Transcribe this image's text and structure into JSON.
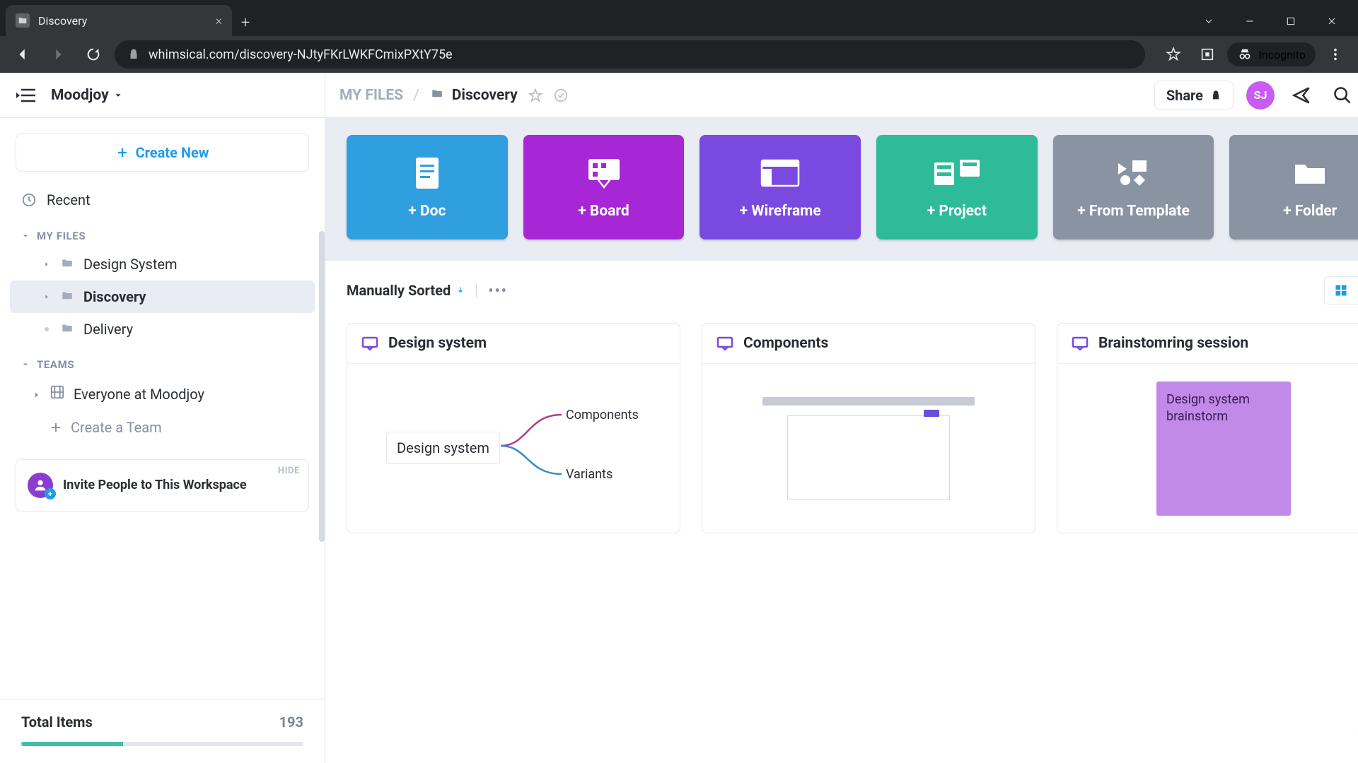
{
  "browser": {
    "tab_title": "Discovery",
    "url_display": "whimsical.com/discovery-NJtyFKrLWKFCmixPXtY75e",
    "incognito_label": "Incognito"
  },
  "header": {
    "workspace": "Moodjoy",
    "breadcrumb_root": "MY FILES",
    "breadcrumb_current": "Discovery",
    "share_label": "Share",
    "avatar_initials": "SJ"
  },
  "sidebar": {
    "create_label": "Create New",
    "recent_label": "Recent",
    "my_files_label": "MY FILES",
    "teams_label": "TEAMS",
    "tree": [
      {
        "label": "Design System",
        "has_children": true,
        "active": false
      },
      {
        "label": "Discovery",
        "has_children": true,
        "active": true
      },
      {
        "label": "Delivery",
        "has_children": false,
        "active": false
      }
    ],
    "team_item": "Everyone at Moodjoy",
    "create_team": "Create a Team",
    "invite_title": "Invite People to This Workspace",
    "invite_hide": "HIDE",
    "total_label": "Total Items",
    "total_count": "193"
  },
  "create_cards": [
    {
      "label": "+ Doc"
    },
    {
      "label": "+ Board"
    },
    {
      "label": "+ Wireframe"
    },
    {
      "label": "+ Project"
    },
    {
      "label": "+ From Template"
    },
    {
      "label": "+ Folder"
    }
  ],
  "sort": {
    "label": "Manually Sorted"
  },
  "files": [
    {
      "title": "Design system",
      "preview_root": "Design system",
      "preview_b1": "Components",
      "preview_b2": "Variants"
    },
    {
      "title": "Components"
    },
    {
      "title": "Brainstomring session",
      "note_text": "Design system brainstorm"
    }
  ]
}
